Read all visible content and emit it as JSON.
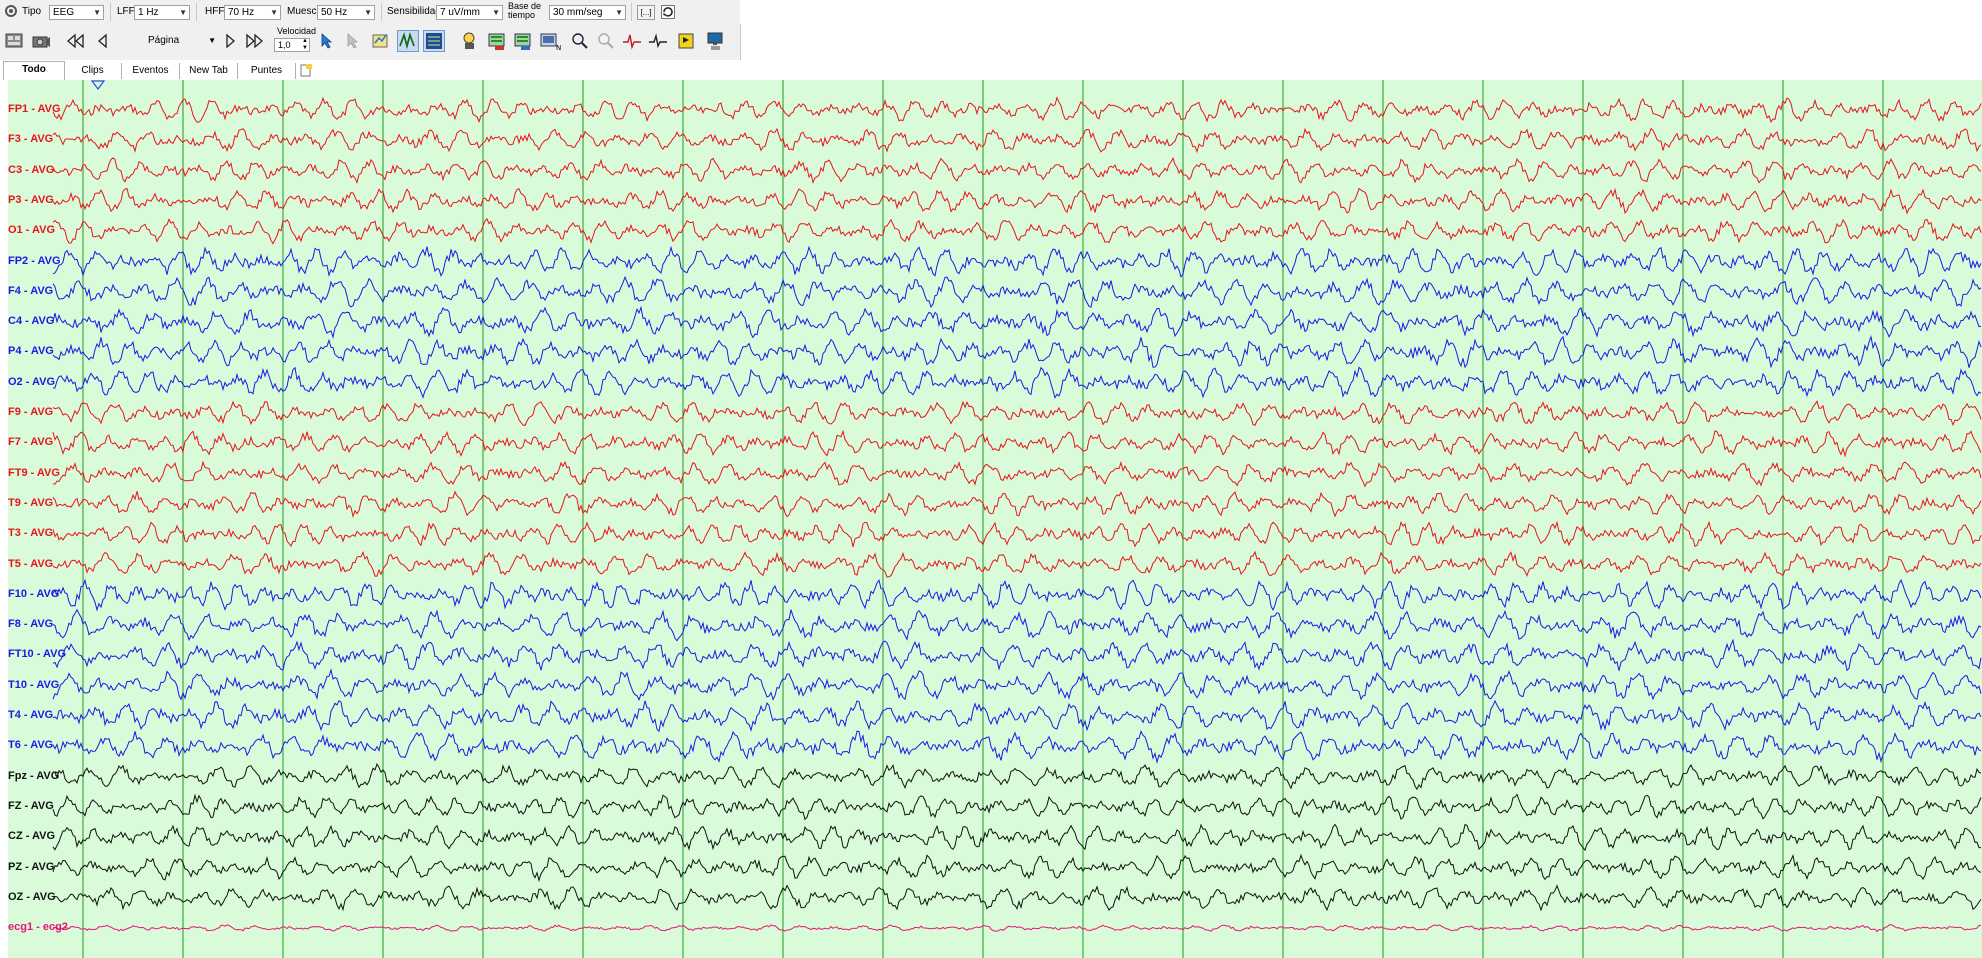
{
  "toolbar": {
    "tipo_label": "Tipo",
    "tipo_value": "EEG",
    "lff_label": "LFF",
    "lff_value": "1 Hz",
    "hff_label": "HFF",
    "hff_value": "70 Hz",
    "muesca_label": "Muesca",
    "muesca_value": "50 Hz",
    "sensibilidad_label": "Sensibilidad",
    "sensibilidad_value": "7 uV/mm",
    "base_tiempo_label_1": "Base de",
    "base_tiempo_label_2": "tiempo",
    "base_tiempo_value": "30 mm/seg",
    "bracket_button": "[...]",
    "pagina_label": "Página",
    "velocidad_label": "Velocidad",
    "velocidad_value": "1,0"
  },
  "tabs": [
    "Todo",
    "Clips",
    "Eventos",
    "New Tab",
    "Puntes"
  ],
  "selected_tab": "Todo",
  "channels": [
    {
      "label": "FP1 - AVG",
      "color": "#e8141c"
    },
    {
      "label": "F3 - AVG",
      "color": "#e8141c"
    },
    {
      "label": "C3 - AVG",
      "color": "#e8141c"
    },
    {
      "label": "P3 - AVG",
      "color": "#e8141c"
    },
    {
      "label": "O1 - AVG",
      "color": "#e8141c"
    },
    {
      "label": "FP2 - AVG",
      "color": "#1a1ae6"
    },
    {
      "label": "F4 - AVG",
      "color": "#1a1ae6"
    },
    {
      "label": "C4 - AVG",
      "color": "#1a1ae6"
    },
    {
      "label": "P4 - AVG",
      "color": "#1a1ae6"
    },
    {
      "label": "O2 - AVG",
      "color": "#1a1ae6"
    },
    {
      "label": "F9 - AVG",
      "color": "#e8141c"
    },
    {
      "label": "F7 - AVG",
      "color": "#e8141c"
    },
    {
      "label": "FT9 - AVG",
      "color": "#e8141c"
    },
    {
      "label": "T9 - AVG",
      "color": "#e8141c"
    },
    {
      "label": "T3 - AVG",
      "color": "#e8141c"
    },
    {
      "label": "T5 - AVG",
      "color": "#e8141c"
    },
    {
      "label": "F10 - AVG",
      "color": "#1a1ae6"
    },
    {
      "label": "F8 - AVG",
      "color": "#1a1ae6"
    },
    {
      "label": "FT10 - AVG",
      "color": "#1a1ae6"
    },
    {
      "label": "T10 - AVG",
      "color": "#1a1ae6"
    },
    {
      "label": "T4 - AVG",
      "color": "#1a1ae6"
    },
    {
      "label": "T6 - AVG",
      "color": "#1a1ae6"
    },
    {
      "label": "Fpz - AVG",
      "color": "#111111"
    },
    {
      "label": "FZ - AVG",
      "color": "#111111"
    },
    {
      "label": "CZ - AVG",
      "color": "#111111"
    },
    {
      "label": "PZ - AVG",
      "color": "#111111"
    },
    {
      "label": "OZ - AVG",
      "color": "#111111"
    },
    {
      "label": "ecg1 - ecg2",
      "color": "#e8147a"
    }
  ],
  "colors": {
    "plot_background": "#d9fbd9",
    "second_gridline": "#1f9a1f",
    "left_hemisphere": "#e8141c",
    "right_hemisphere": "#1a1ae6",
    "midline": "#111111",
    "ecg": "#e8147a"
  }
}
